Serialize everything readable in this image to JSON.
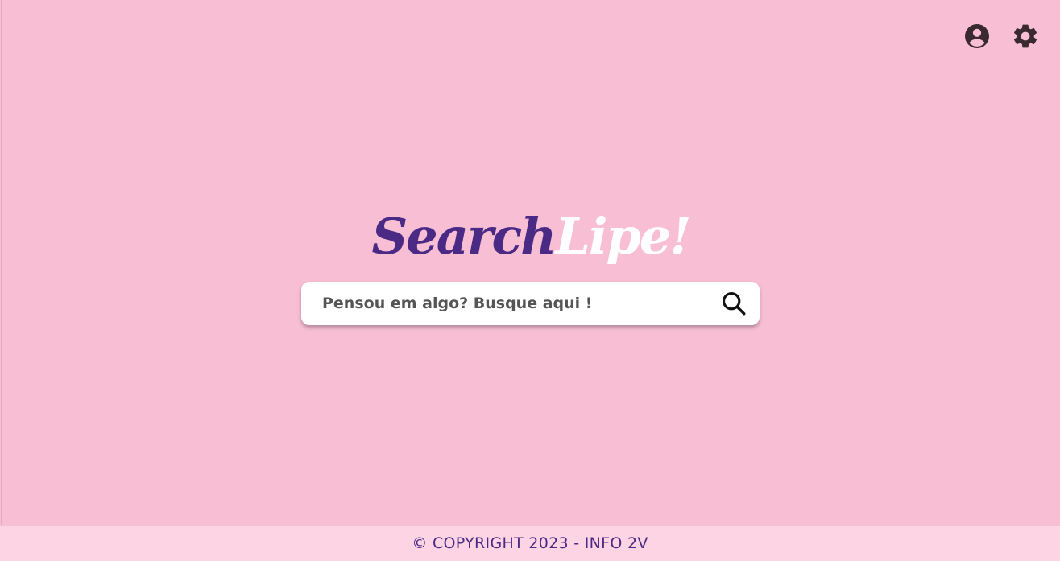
{
  "colors": {
    "background": "#f7bed4",
    "footer_background": "#fdd4e4",
    "brand_primary": "#4b2a85",
    "brand_secondary": "#ffffff",
    "icon_color": "#3a2a30"
  },
  "header": {
    "icons": [
      {
        "name": "account-circle-icon"
      },
      {
        "name": "gear-icon"
      }
    ]
  },
  "logo": {
    "part1": "Search",
    "part2": "Lipe!"
  },
  "search": {
    "placeholder": "Pensou em algo? Busque aqui !",
    "value": "",
    "button_icon": "search-icon"
  },
  "footer": {
    "text": "© COPYRIGHT 2023 - INFO 2V"
  }
}
